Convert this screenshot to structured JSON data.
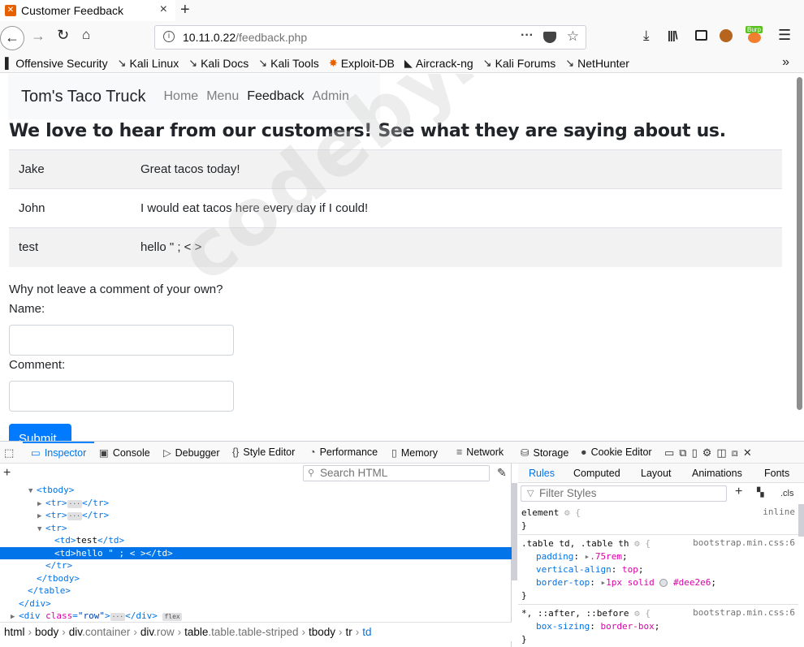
{
  "browser": {
    "tab": {
      "title": "Customer Feedback"
    },
    "url": {
      "host": "10.11.0.22",
      "path": "/feedback.php"
    },
    "toolbar": {
      "burp_badge": "Burp"
    },
    "bookmarks": [
      "Offensive Security",
      "Kali Linux",
      "Kali Docs",
      "Kali Tools",
      "Exploit-DB",
      "Aircrack-ng",
      "Kali Forums",
      "NetHunter"
    ]
  },
  "site": {
    "brand": "Tom's Taco Truck",
    "nav": [
      "Home",
      "Menu",
      "Feedback",
      "Admin"
    ],
    "active_nav": "Feedback",
    "heading": "We love to hear from our customers! See what they are saying about us.",
    "feedback": [
      {
        "name": "Jake",
        "comment": "Great tacos today!"
      },
      {
        "name": "John",
        "comment": "I would eat tacos here every day if I could!"
      },
      {
        "name": "test",
        "comment": "hello \" ; < >"
      }
    ],
    "form": {
      "invite": "Why not leave a comment of your own?",
      "name_label": "Name:",
      "comment_label": "Comment:",
      "submit_label": "Submit"
    },
    "watermark": "codeby.net"
  },
  "devtools": {
    "tabs": [
      "Inspector",
      "Console",
      "Debugger",
      "Style Editor",
      "Performance",
      "Memory",
      "Network",
      "Storage",
      "Cookie Editor"
    ],
    "active_tab": "Inspector",
    "search_placeholder": "Search HTML",
    "tree": [
      {
        "indent": 3,
        "tw": "▼",
        "parts": [
          {
            "c": "tag",
            "t": "<tbody>"
          }
        ]
      },
      {
        "indent": 4,
        "tw": "▶",
        "parts": [
          {
            "c": "tag",
            "t": "<tr>"
          },
          {
            "c": "badge",
            "t": "···"
          },
          {
            "c": "tag",
            "t": "</tr>"
          }
        ]
      },
      {
        "indent": 4,
        "tw": "▶",
        "parts": [
          {
            "c": "tag",
            "t": "<tr>"
          },
          {
            "c": "badge",
            "t": "···"
          },
          {
            "c": "tag",
            "t": "</tr>"
          }
        ]
      },
      {
        "indent": 4,
        "tw": "▼",
        "parts": [
          {
            "c": "tag",
            "t": "<tr>"
          }
        ]
      },
      {
        "indent": 5,
        "tw": "",
        "parts": [
          {
            "c": "tag",
            "t": "<td>"
          },
          {
            "c": "tx",
            "t": "test"
          },
          {
            "c": "tag",
            "t": "</td>"
          }
        ]
      },
      {
        "indent": 5,
        "tw": "",
        "sel": true,
        "parts": [
          {
            "c": "tag",
            "t": "<td>"
          },
          {
            "c": "tx",
            "t": "hello \" ; < >"
          },
          {
            "c": "tag",
            "t": "</td>"
          }
        ]
      },
      {
        "indent": 4,
        "tw": "",
        "parts": [
          {
            "c": "tag",
            "t": "</tr>"
          }
        ]
      },
      {
        "indent": 3,
        "tw": "",
        "parts": [
          {
            "c": "tag",
            "t": "</tbody>"
          }
        ]
      },
      {
        "indent": 2,
        "tw": "",
        "parts": [
          {
            "c": "tag",
            "t": "</table>"
          }
        ]
      },
      {
        "indent": 1,
        "tw": "",
        "parts": [
          {
            "c": "tag",
            "t": "</div>"
          }
        ]
      },
      {
        "indent": 1,
        "tw": "▶",
        "parts": [
          {
            "c": "tag",
            "t": "<div "
          },
          {
            "c": "at",
            "t": "class"
          },
          {
            "c": "tag",
            "t": "="
          },
          {
            "c": "av",
            "t": "\"row\""
          },
          {
            "c": "tag",
            "t": ">"
          },
          {
            "c": "badge",
            "t": "···"
          },
          {
            "c": "tag",
            "t": "</div> "
          },
          {
            "c": "badge",
            "t": "flex"
          }
        ]
      }
    ],
    "breadcrumbs": [
      {
        "tag": "html",
        "cls": ""
      },
      {
        "tag": "body",
        "cls": ""
      },
      {
        "tag": "div",
        "cls": ".container"
      },
      {
        "tag": "div",
        "cls": ".row"
      },
      {
        "tag": "table",
        "cls": ".table.table-striped"
      },
      {
        "tag": "tbody",
        "cls": ""
      },
      {
        "tag": "tr",
        "cls": ""
      },
      {
        "tag": "td",
        "cls": ""
      }
    ],
    "sidebar_tabs": [
      "Rules",
      "Computed",
      "Layout",
      "Animations",
      "Fonts"
    ],
    "sidebar_active": "Rules",
    "filter_placeholder": "Filter Styles",
    "cls_label": ".cls",
    "rules": [
      {
        "selector": "element",
        "source": "inline",
        "props": []
      },
      {
        "selector": ".table td, .table th",
        "source": "bootstrap.min.css:6",
        "props": [
          {
            "name": "padding",
            "value": ".75rem",
            "expand": true
          },
          {
            "name": "vertical-align",
            "value": "top"
          },
          {
            "name": "border-top",
            "value": "1px solid",
            "swatch": "#dee2e6",
            "swatch_text": "#dee2e6",
            "expand": true
          }
        ]
      },
      {
        "selector": "*, ::after, ::before",
        "source": "bootstrap.min.css:6",
        "props": [
          {
            "name": "box-sizing",
            "value": "border-box"
          }
        ]
      }
    ]
  },
  "colors": {
    "accent": "#0074e8",
    "submit": "#007bff",
    "stripe": "#f2f2f2"
  }
}
